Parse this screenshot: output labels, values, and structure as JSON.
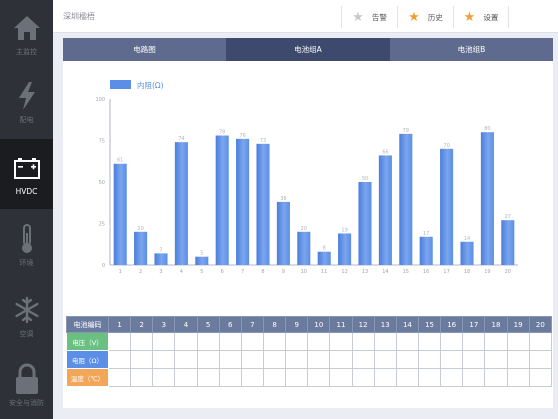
{
  "sidebar": {
    "items": [
      {
        "label": "主监控",
        "icon": "home-icon",
        "active": false
      },
      {
        "label": "配电",
        "icon": "lightning-icon",
        "active": false
      },
      {
        "label": "HVDC",
        "icon": "battery-icon",
        "active": true
      },
      {
        "label": "环境",
        "icon": "thermometer-icon",
        "active": false
      },
      {
        "label": "空调",
        "icon": "snowflake-icon",
        "active": false
      },
      {
        "label": "安全与消防",
        "icon": "lock-icon",
        "active": false
      }
    ]
  },
  "topbar": {
    "location": "深圳楹梧",
    "buttons": [
      {
        "label": "告警",
        "icon": "star-icon",
        "color": "#c8c8c8"
      },
      {
        "label": "历史",
        "icon": "star-icon",
        "color": "#f0a030"
      },
      {
        "label": "设置",
        "icon": "star-icon",
        "color": "#f0a030"
      }
    ]
  },
  "tabs": [
    {
      "label": "电路图",
      "active": false
    },
    {
      "label": "电池组A",
      "active": true
    },
    {
      "label": "电池组B",
      "active": false
    }
  ],
  "chart_data": {
    "type": "bar",
    "series": [
      {
        "name": "内阻(Ω)",
        "values": [
          61,
          20,
          7,
          74,
          5,
          78,
          76,
          73,
          38,
          20,
          8,
          19,
          50,
          66,
          79,
          17,
          70,
          14,
          80,
          27
        ]
      }
    ],
    "categories": [
      "1",
      "2",
      "3",
      "4",
      "5",
      "6",
      "7",
      "8",
      "9",
      "10",
      "11",
      "12",
      "13",
      "14",
      "15",
      "16",
      "17",
      "18",
      "19",
      "20"
    ],
    "ylim": [
      0,
      100
    ],
    "yticks": [
      0,
      25,
      50,
      75,
      100
    ],
    "legend_position": "top-left",
    "grid": false,
    "bar_color": "#5b8ee6"
  },
  "table": {
    "corner": "电池编码",
    "columns": [
      "1",
      "2",
      "3",
      "4",
      "5",
      "6",
      "7",
      "8",
      "9",
      "10",
      "11",
      "12",
      "13",
      "14",
      "15",
      "16",
      "17",
      "18",
      "19",
      "20"
    ],
    "rows": [
      {
        "label": "电压（V）",
        "color": "#69c080"
      },
      {
        "label": "电阻（Ω）",
        "color": "#5b8ee6"
      },
      {
        "label": "温度（℃）",
        "color": "#f2a65a"
      }
    ]
  }
}
